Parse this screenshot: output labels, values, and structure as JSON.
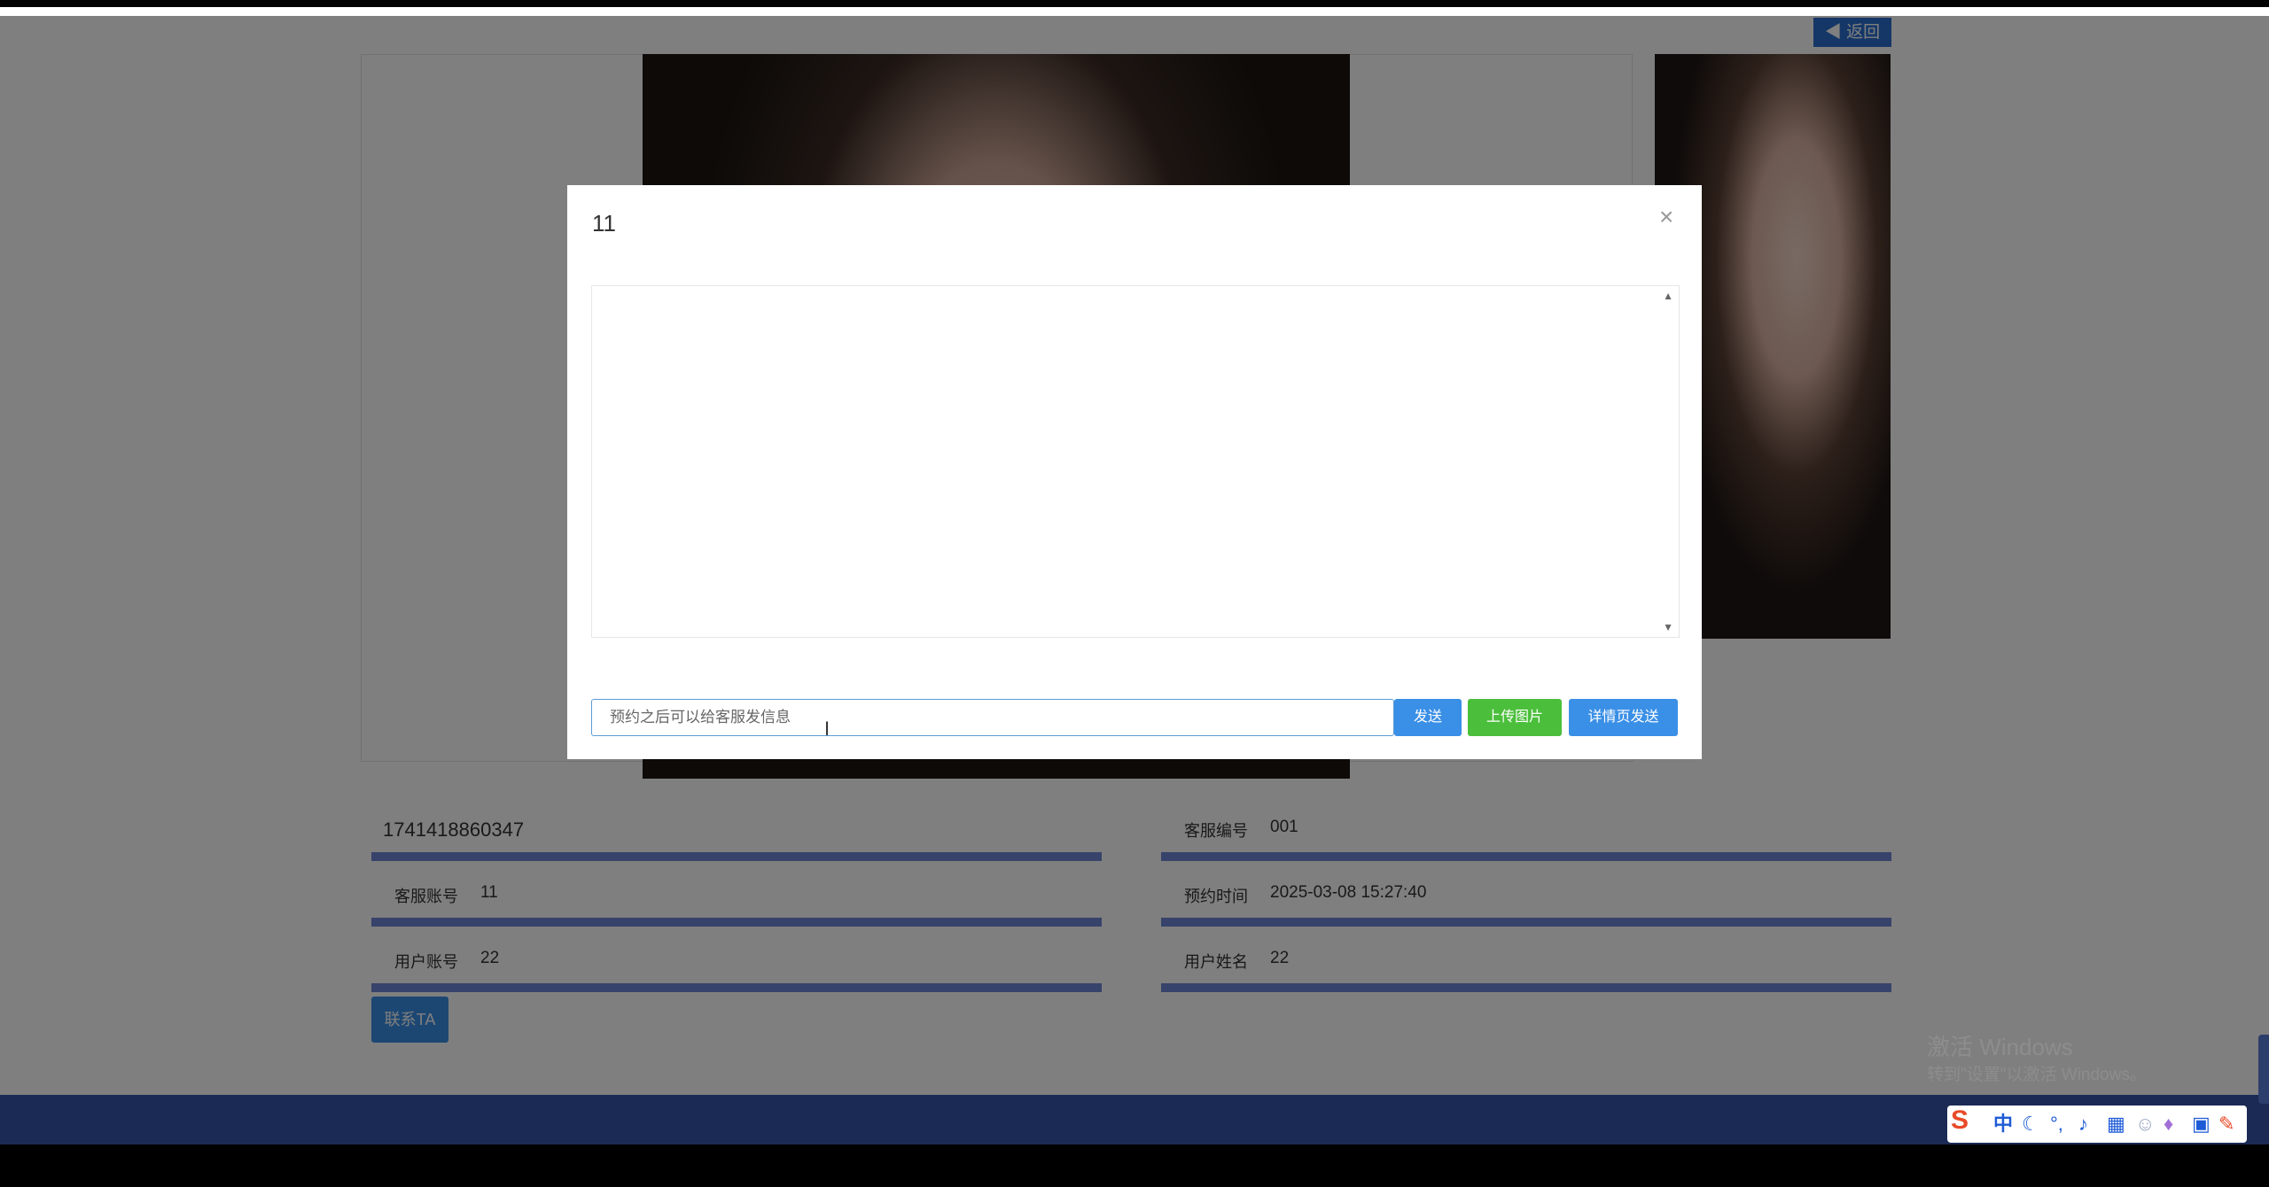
{
  "header": {
    "back_label": "返回"
  },
  "detail": {
    "id": "1741418860347",
    "service_no_label": "客服编号",
    "service_no": "001",
    "service_account_label": "客服账号",
    "service_account": "11",
    "appointment_time_label": "预约时间",
    "appointment_time": "2025-03-08 15:27:40",
    "user_account_label": "用户账号",
    "user_account": "22",
    "user_name_label": "用户姓名",
    "user_name": "22",
    "contact_label": "联系TA"
  },
  "modal": {
    "title": "11",
    "close_icon": "×",
    "input_placeholder": "预约之后可以给客服发信息",
    "send_label": "发送",
    "upload_label": "上传图片",
    "detail_send_label": "详情页发送"
  },
  "windows_watermark": {
    "line1": "激活 Windows",
    "line2": "转到\"设置\"以激活 Windows。"
  },
  "tray": {
    "icons": [
      "sogou-ime-icon",
      "zh-mode-icon",
      "moon-icon",
      "punctuation-icon",
      "mic-icon",
      "keyboard-icon",
      "user-icon",
      "skin-icon",
      "apps-icon",
      "tools-icon"
    ],
    "zh_label": "中"
  }
}
